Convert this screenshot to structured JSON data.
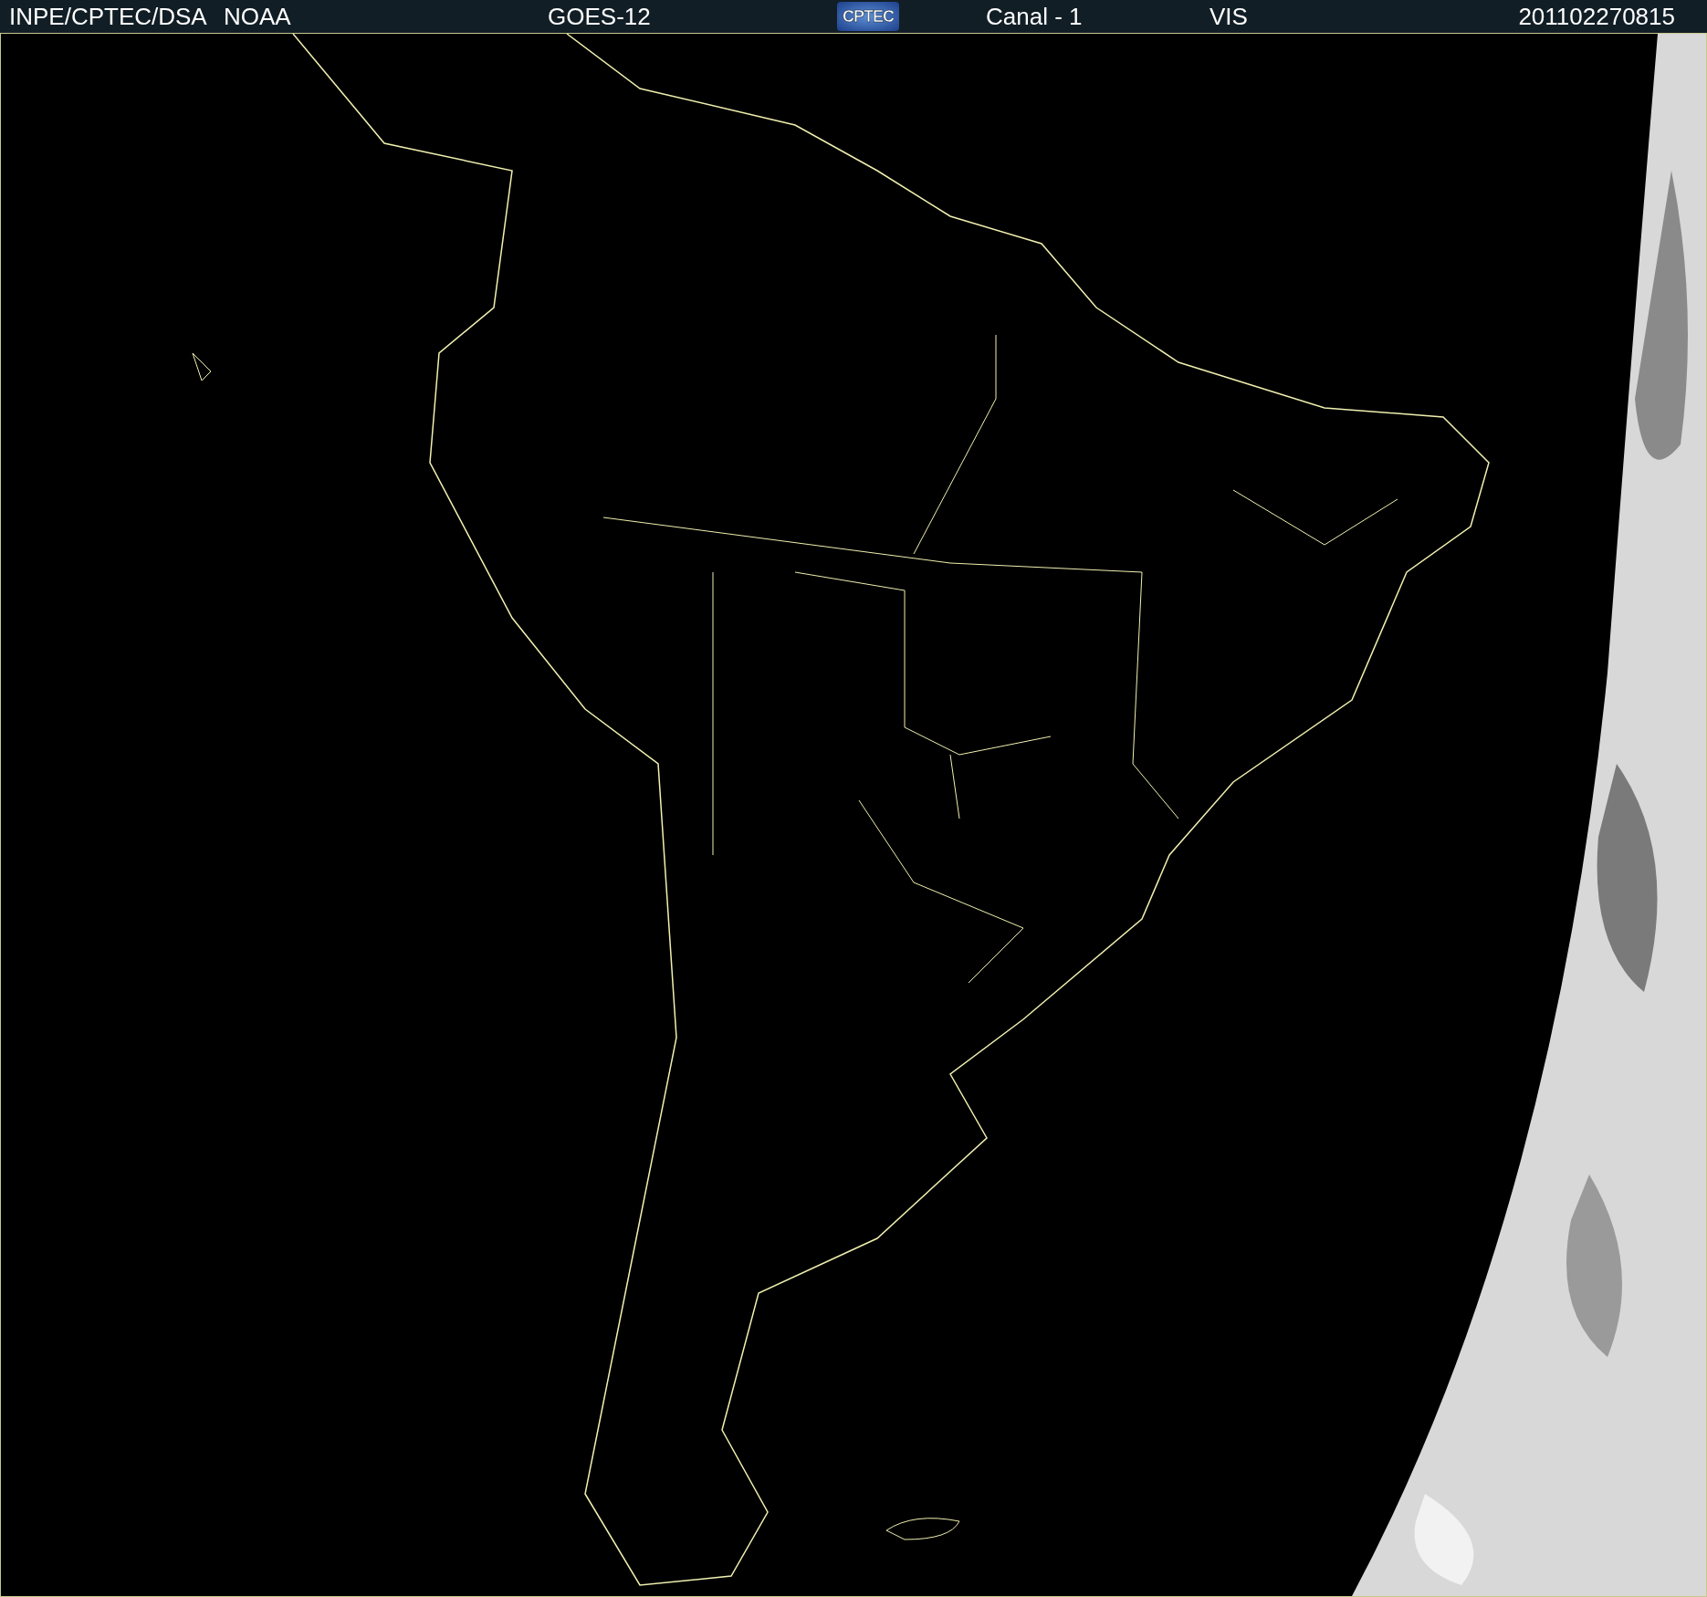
{
  "header": {
    "agency": "INPE/CPTEC/DSA",
    "source": "NOAA",
    "satellite": "GOES-12",
    "logo_text": "CPTEC",
    "channel": "Canal - 1",
    "band": "VIS",
    "timestamp": "201102270815"
  }
}
